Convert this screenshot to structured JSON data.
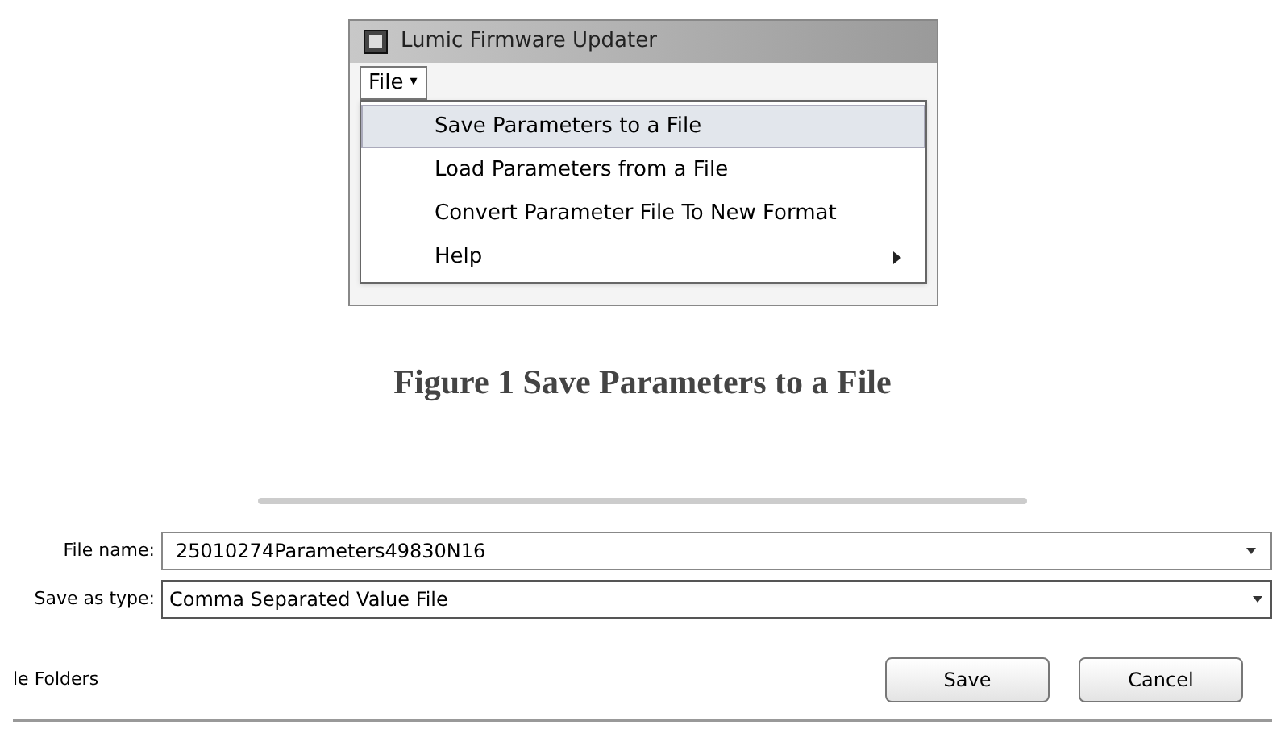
{
  "menu_window": {
    "title": "Lumic Firmware Updater",
    "menu_bar": {
      "label": "File",
      "caret": "▾"
    },
    "menu_items": [
      {
        "label": "Save Parameters to a File",
        "selected": true,
        "submenu": false
      },
      {
        "label": "Load Parameters from a File",
        "selected": false,
        "submenu": false
      },
      {
        "label": "Convert Parameter File To New Format",
        "selected": false,
        "submenu": false
      },
      {
        "label": "Help",
        "selected": false,
        "submenu": true
      }
    ]
  },
  "caption": "Figure 1 Save Parameters to a File",
  "save_dialog": {
    "file_name_label": "File name:",
    "file_name": "25010274Parameters49830N16",
    "type_label": "Save as type:",
    "type_value": "Comma Separated Value File",
    "folders_toggle": "le Folders",
    "buttons": [
      "Save",
      "Cancel"
    ]
  }
}
